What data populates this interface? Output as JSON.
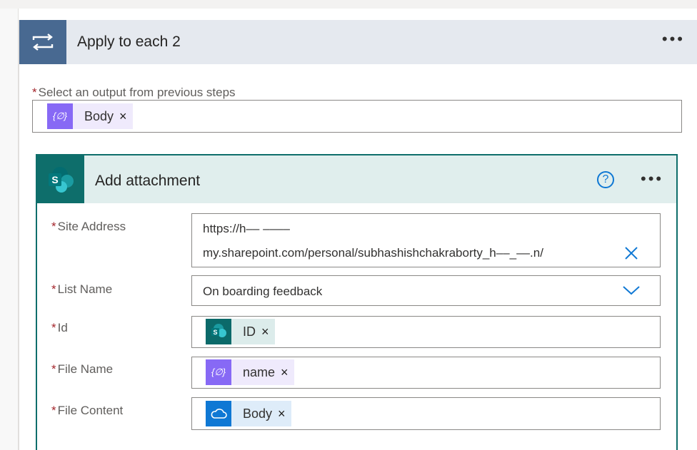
{
  "loop": {
    "title": "Apply to each 2",
    "icon": "loop-icon",
    "more_label": "•••",
    "select_output_label": "Select an output from previous steps",
    "token": {
      "label": "Body",
      "remove": "×",
      "icon": "expression-icon"
    }
  },
  "action": {
    "title": "Add attachment",
    "icon": "sharepoint-icon",
    "help_label": "?",
    "more_label": "•••",
    "required_mark": "*",
    "site_address": {
      "label": "Site Address",
      "value_line1": "https://h‒‒ ‒‒‒‒",
      "value_line2": "my.sharepoint.com/personal/subhashishchakraborty_h‒‒_‒‒.n/",
      "clear": "×"
    },
    "list_name": {
      "label": "List Name",
      "value": "On boarding feedback"
    },
    "id": {
      "label": "Id",
      "token": "ID",
      "remove": "×",
      "icon": "sharepoint-icon"
    },
    "file_name": {
      "label": "File Name",
      "token": "name",
      "remove": "×",
      "icon": "expression-icon"
    },
    "file_content": {
      "label": "File Content",
      "token": "Body",
      "remove": "×",
      "icon": "onedrive-icon"
    }
  },
  "colors": {
    "loop_header": "#486991",
    "action_accent": "#0e6e6b",
    "required": "#a4262c",
    "link_blue": "#0f78d4",
    "expression_purple": "#8769f5"
  }
}
